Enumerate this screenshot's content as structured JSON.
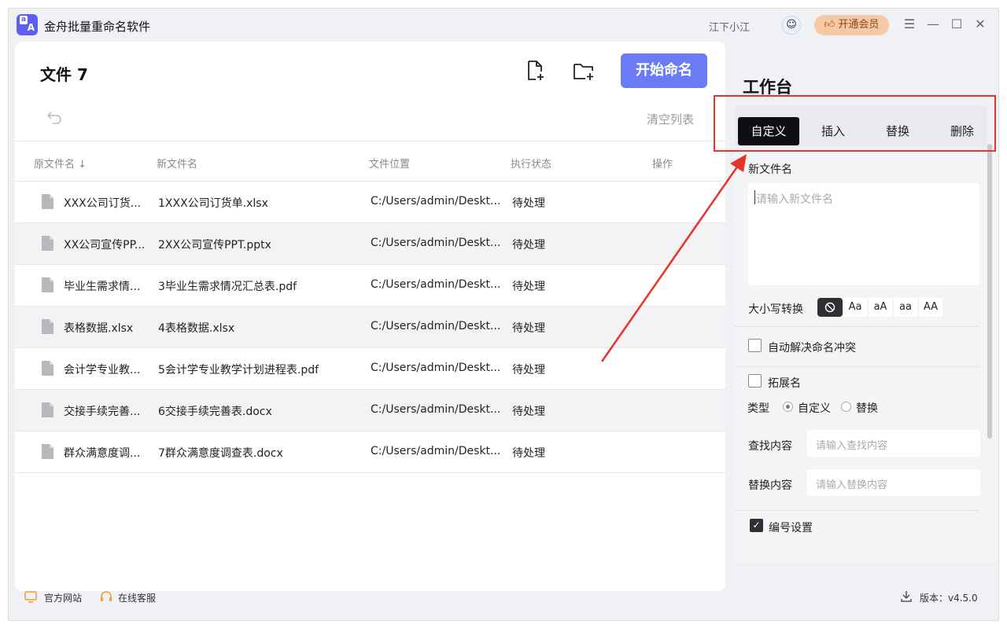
{
  "app": {
    "title": "金舟批量重命名软件",
    "username": "江下小江",
    "vip_label": "开通会员"
  },
  "window_controls": {
    "menu": "☰",
    "minimize": "—",
    "maximize": "☐",
    "close": "✕"
  },
  "toolbar": {
    "files_title": "文件 7",
    "start_label": "开始命名",
    "clear_label": "清空列表"
  },
  "table": {
    "headers": [
      "原文件名 ↓",
      "新文件名",
      "文件位置",
      "执行状态",
      "操作"
    ],
    "rows": [
      {
        "orig": "XXX公司订货...",
        "new": "1XXX公司订货单.xlsx",
        "path": "C:/Users/admin/Deskt...",
        "status": "待处理"
      },
      {
        "orig": "XX公司宣传PP...",
        "new": "2XX公司宣传PPT.pptx",
        "path": "C:/Users/admin/Deskt...",
        "status": "待处理"
      },
      {
        "orig": "毕业生需求情...",
        "new": "3毕业生需求情况汇总表.pdf",
        "path": "C:/Users/admin/Deskt...",
        "status": "待处理"
      },
      {
        "orig": "表格数据.xlsx",
        "new": "4表格数据.xlsx",
        "path": "C:/Users/admin/Deskt...",
        "status": "待处理"
      },
      {
        "orig": "会计学专业教...",
        "new": "5会计学专业教学计划进程表.pdf",
        "path": "C:/Users/admin/Deskt...",
        "status": "待处理"
      },
      {
        "orig": "交接手续完善...",
        "new": "6交接手续完善表.docx",
        "path": "C:/Users/admin/Deskt...",
        "status": "待处理"
      },
      {
        "orig": "群众满意度调...",
        "new": "7群众满意度调查表.docx",
        "path": "C:/Users/admin/Deskt...",
        "status": "待处理"
      }
    ]
  },
  "workbench": {
    "title": "工作台",
    "tabs": [
      "自定义",
      "插入",
      "替换",
      "删除"
    ],
    "active_tab": "自定义",
    "new_name_label": "新文件名",
    "new_name_placeholder": "请输入新文件名",
    "case_label": "大小写转换",
    "case_options": [
      "Aa",
      "aA",
      "aa",
      "AA"
    ],
    "auto_conflict_label": "自动解决命名冲突",
    "ext_label": "拓展名",
    "type_label": "类型",
    "type_options": [
      "自定义",
      "替换"
    ],
    "find_label": "查找内容",
    "find_placeholder": "请输入查找内容",
    "replace_label": "替换内容",
    "replace_placeholder": "请输入替换内容",
    "numbering_label": "编号设置",
    "numbering_checked": true
  },
  "footer": {
    "website_label": "官方网站",
    "support_label": "在线客服",
    "version_label": "版本：v4.5.0"
  },
  "colors": {
    "accent": "#6b7bf6",
    "active_tab": "#0e0f12",
    "annotation": "#e8332a",
    "vip": "#f6c9a4"
  }
}
